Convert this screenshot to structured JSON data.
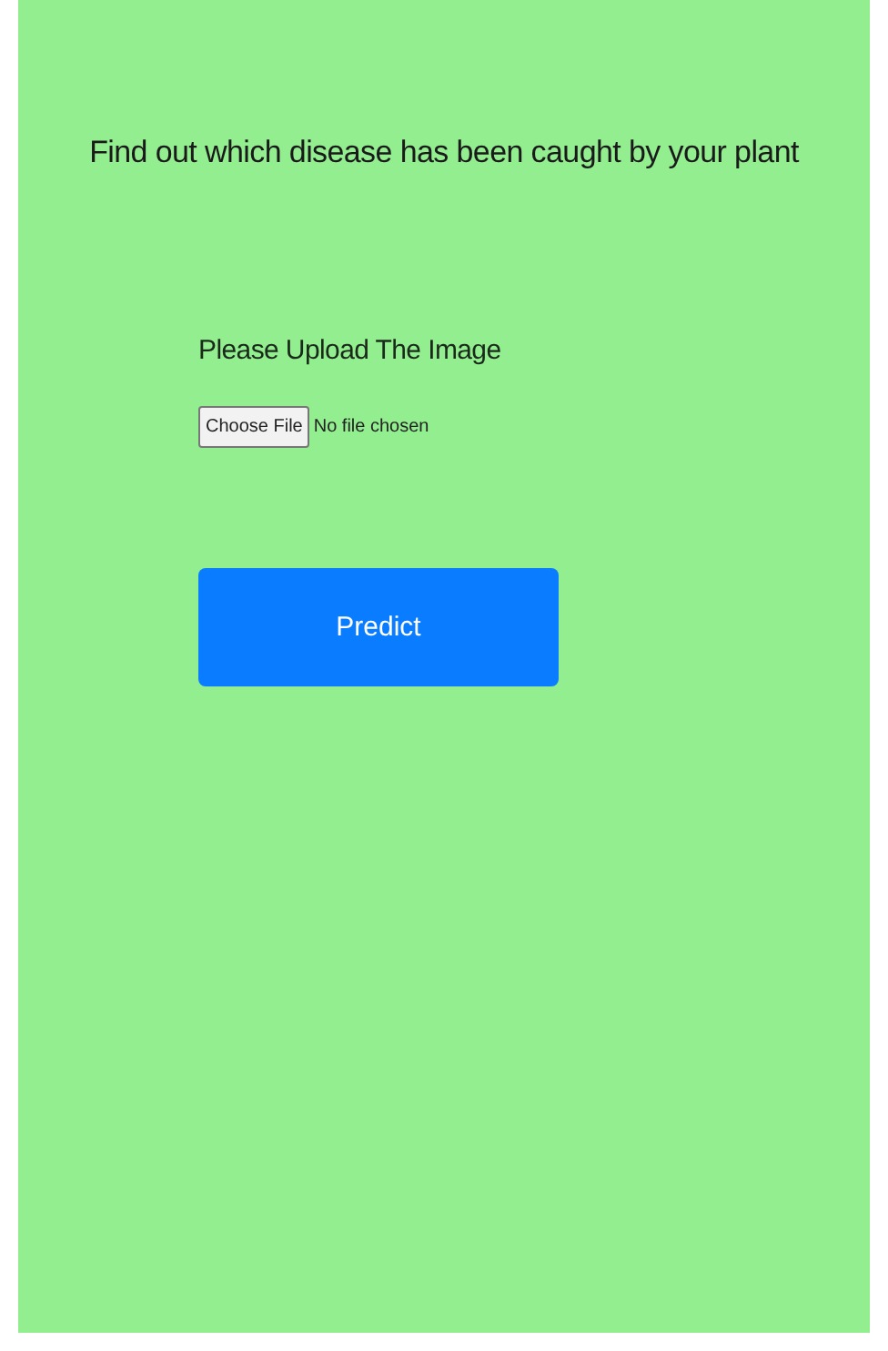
{
  "heading": "Find out which disease has been caught by your plant",
  "upload": {
    "label": "Please Upload The Image",
    "button": "Choose File",
    "status": "No file chosen"
  },
  "submit": {
    "label": "Predict"
  }
}
